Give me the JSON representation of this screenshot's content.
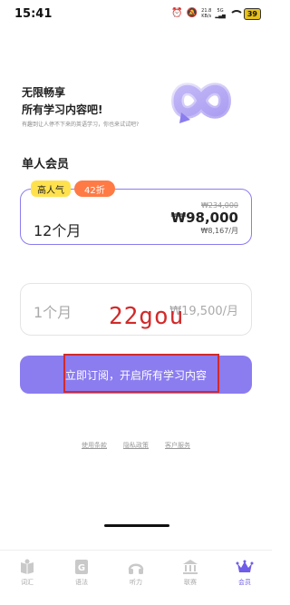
{
  "status_bar": {
    "time": "15:41",
    "speed_value": "21.8",
    "speed_unit": "KB/s",
    "network": "5G",
    "battery": "39"
  },
  "hero": {
    "title_line1": "无限畅享",
    "title_line2": "所有学习内容吧!",
    "subtitle": "有趣到让人停不下来的英语学习，你也来试试吧?"
  },
  "section_title": "单人会员",
  "plans": [
    {
      "name": "12个月",
      "old_price": "₩234,000",
      "price": "₩98,000",
      "monthly": "₩8,167/月",
      "badge_popular": "高人气",
      "badge_discount": "42折"
    },
    {
      "name": "1个月",
      "price": "₩19,500/月"
    }
  ],
  "watermark": "22gou",
  "cta_label": "立即订阅，开启所有学习内容",
  "footer_links": [
    "使用条款",
    "隐私政策",
    "客户服务"
  ],
  "bottom_nav": [
    {
      "label": "词汇",
      "icon": "book-icon",
      "active": false
    },
    {
      "label": "语法",
      "icon": "grammar-g-icon",
      "active": false
    },
    {
      "label": "听力",
      "icon": "headphones-icon",
      "active": false
    },
    {
      "label": "联赛",
      "icon": "league-icon",
      "active": false
    },
    {
      "label": "会员",
      "icon": "crown-icon",
      "active": true
    }
  ],
  "colors": {
    "accent": "#8b7cf0",
    "nav_active": "#6f5de8",
    "popular_badge": "#ffe14d",
    "discount_badge": "#ff7a45",
    "annotation_red": "#d22a2a"
  }
}
